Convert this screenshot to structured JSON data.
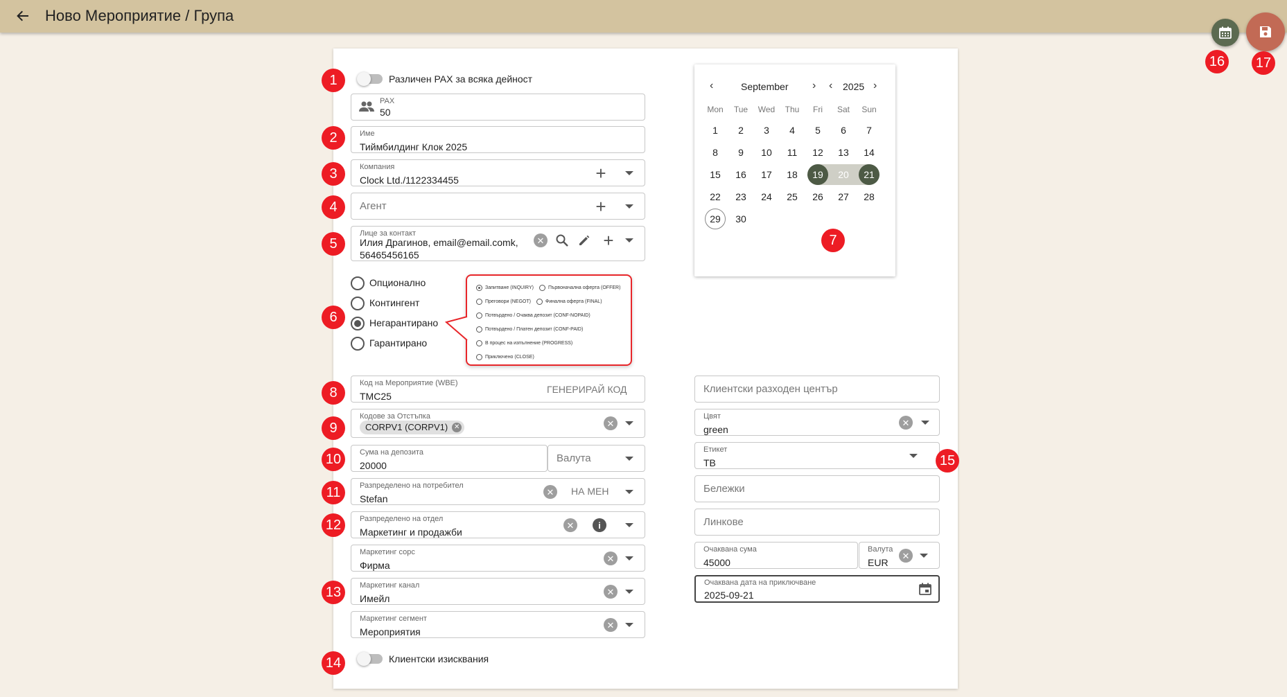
{
  "header": {
    "title": "Ново Мероприятие / Група"
  },
  "badges": [
    "1",
    "2",
    "3",
    "4",
    "5",
    "6",
    "7",
    "8",
    "9",
    "10",
    "11",
    "12",
    "13",
    "14",
    "15",
    "16",
    "17"
  ],
  "left": {
    "pax_toggle_label": "Различен PAX за всяка дейност",
    "pax": {
      "label": "PAX",
      "value": "50"
    },
    "name": {
      "label": "Име",
      "value": "Тиймбилдинг Клок 2025"
    },
    "company": {
      "label": "Компания",
      "value": "Clock Ltd./1122334455"
    },
    "agent": {
      "placeholder": "Агент"
    },
    "contact": {
      "label": "Лице за контакт",
      "value_line1": "Илия Драгинов, email@email.comk,",
      "value_line2": "56465456165"
    },
    "status_radios": [
      {
        "label": "Опционално",
        "selected": false
      },
      {
        "label": "Контингент",
        "selected": false
      },
      {
        "label": "Негарантирано",
        "selected": true
      },
      {
        "label": "Гарантирано",
        "selected": false
      }
    ],
    "event_code": {
      "label": "Код на Мероприятие (WBE)",
      "value": "TMC25",
      "button": "ГЕНЕРИРАЙ КОД"
    },
    "discount_codes": {
      "label": "Кодове за Отстъпка",
      "chip": "CORPV1 (CORPV1)"
    },
    "deposit": {
      "label": "Сума на депозита",
      "value": "20000",
      "currency_placeholder": "Валута"
    },
    "assigned_user": {
      "label": "Разпределено на потребител",
      "value": "Stefan",
      "button": "НА МЕН"
    },
    "assigned_dept": {
      "label": "Разпределено на отдел",
      "value": "Маркетинг и продажби"
    },
    "marketing_source": {
      "label": "Маркетинг сорс",
      "value": "Фирма"
    },
    "marketing_channel": {
      "label": "Маркетинг канал",
      "value": "Имейл"
    },
    "marketing_segment": {
      "label": "Маркетинг сегмент",
      "value": "Мероприятия"
    },
    "client_req_label": "Клиентски изисквания"
  },
  "callout_options": [
    {
      "label": "Запитване (INQUIRY)",
      "selected": true
    },
    {
      "label": "Първоначална оферта (OFFER)",
      "selected": false
    },
    {
      "label": "Преговори (NEGOT)",
      "selected": false
    },
    {
      "label": "Финална оферта (FINAL)",
      "selected": false
    },
    {
      "label": "Потвърдено / Очаква депозит (CONF-NOPAID)",
      "selected": false
    },
    {
      "label": "Потвърдено / Платен депозит (CONF-PAID)",
      "selected": false
    },
    {
      "label": "В процес на изпълнение (PROGRESS)",
      "selected": false
    },
    {
      "label": "Приключено (CLOSE)",
      "selected": false
    }
  ],
  "calendar": {
    "month": "September",
    "year": "2025",
    "weekdays": [
      "Mon",
      "Tue",
      "Wed",
      "Thu",
      "Fri",
      "Sat",
      "Sun"
    ],
    "days": [
      "1",
      "2",
      "3",
      "4",
      "5",
      "6",
      "7",
      "8",
      "9",
      "10",
      "11",
      "12",
      "13",
      "14",
      "15",
      "16",
      "17",
      "18",
      "19",
      "20",
      "21",
      "22",
      "23",
      "24",
      "25",
      "26",
      "27",
      "28",
      "29",
      "30"
    ],
    "range_start": 19,
    "range_end": 21,
    "today": 29
  },
  "right": {
    "cost_center": {
      "placeholder": "Клиентски разходен център"
    },
    "color": {
      "label": "Цвят",
      "value": "green"
    },
    "tag": {
      "label": "Етикет",
      "value": "TB"
    },
    "notes": {
      "placeholder": "Бележки"
    },
    "links": {
      "placeholder": "Линкове"
    },
    "expected_amount": {
      "label": "Очаквана сума",
      "value": "45000"
    },
    "currency": {
      "label": "Валута",
      "value": "EUR"
    },
    "expected_close": {
      "label": "Очаквана дата на приключване",
      "value": "2025-09-21"
    }
  },
  "colors": {
    "topbar": "#d3c39f",
    "background": "#f5efe6",
    "calendar_fab": "#5b6a50",
    "save_fab": "#c26a55",
    "badge": "#ed1c24",
    "range_selected": "#4d5a45"
  }
}
